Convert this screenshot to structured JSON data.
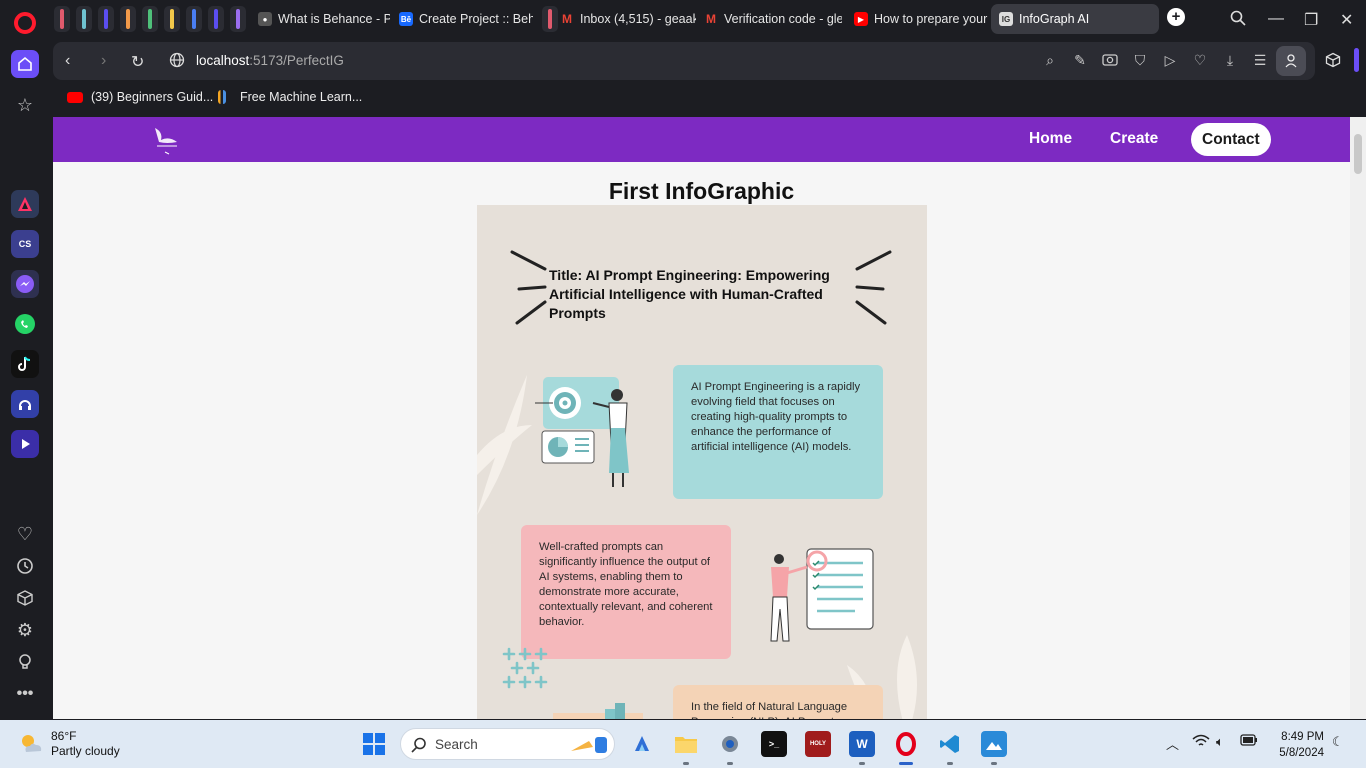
{
  "browser": {
    "tabs": [
      {
        "title": "What is Behance - Po",
        "icon": "behance-chat-icon"
      },
      {
        "title": "Create Project :: Beha",
        "icon": "behance-icon"
      },
      {
        "title": "Inbox (4,515) - geaak",
        "icon": "gmail-icon"
      },
      {
        "title": "Verification code - gle",
        "icon": "gmail-icon"
      },
      {
        "title": "How to prepare your",
        "icon": "youtube-icon"
      },
      {
        "title": "InfoGraph AI",
        "icon": "infograph-icon",
        "active": true
      }
    ],
    "url_host": "localhost",
    "url_path": ":5173/PerfectIG",
    "bookmarks": [
      {
        "label": "(39) Beginners Guid...",
        "icon": "youtube-icon"
      },
      {
        "label": "Free Machine Learn...",
        "icon": "ml-icon"
      }
    ],
    "accent": "#6b4ef7"
  },
  "app": {
    "brand_color": "#7d2ac2",
    "nav": {
      "home": "Home",
      "create": "Create",
      "contact": "Contact"
    },
    "page_title": "First InfoGraphic",
    "infographic": {
      "title": "Title: AI Prompt Engineering: Empowering Artificial Intelligence with Human-Crafted Prompts",
      "section1": "AI Prompt Engineering is a rapidly evolving field that focuses on creating high-quality prompts to enhance the performance of artificial intelligence (AI) models.",
      "section2": "Well-crafted prompts can significantly influence the output of AI systems, enabling them to demonstrate more accurate, contextually relevant, and coherent behavior.",
      "section3": "In the field of Natural Language Processing (NLP), AI Prompt",
      "colors": {
        "background": "#e6e0d9",
        "teal": "#a6dadb",
        "pink": "#f5b8bb",
        "peach": "#f4d3b6"
      }
    }
  },
  "taskbar": {
    "temperature": "86°F",
    "weather": "Partly cloudy",
    "search_placeholder": "Search",
    "time": "8:49 PM",
    "date": "5/8/2024"
  }
}
